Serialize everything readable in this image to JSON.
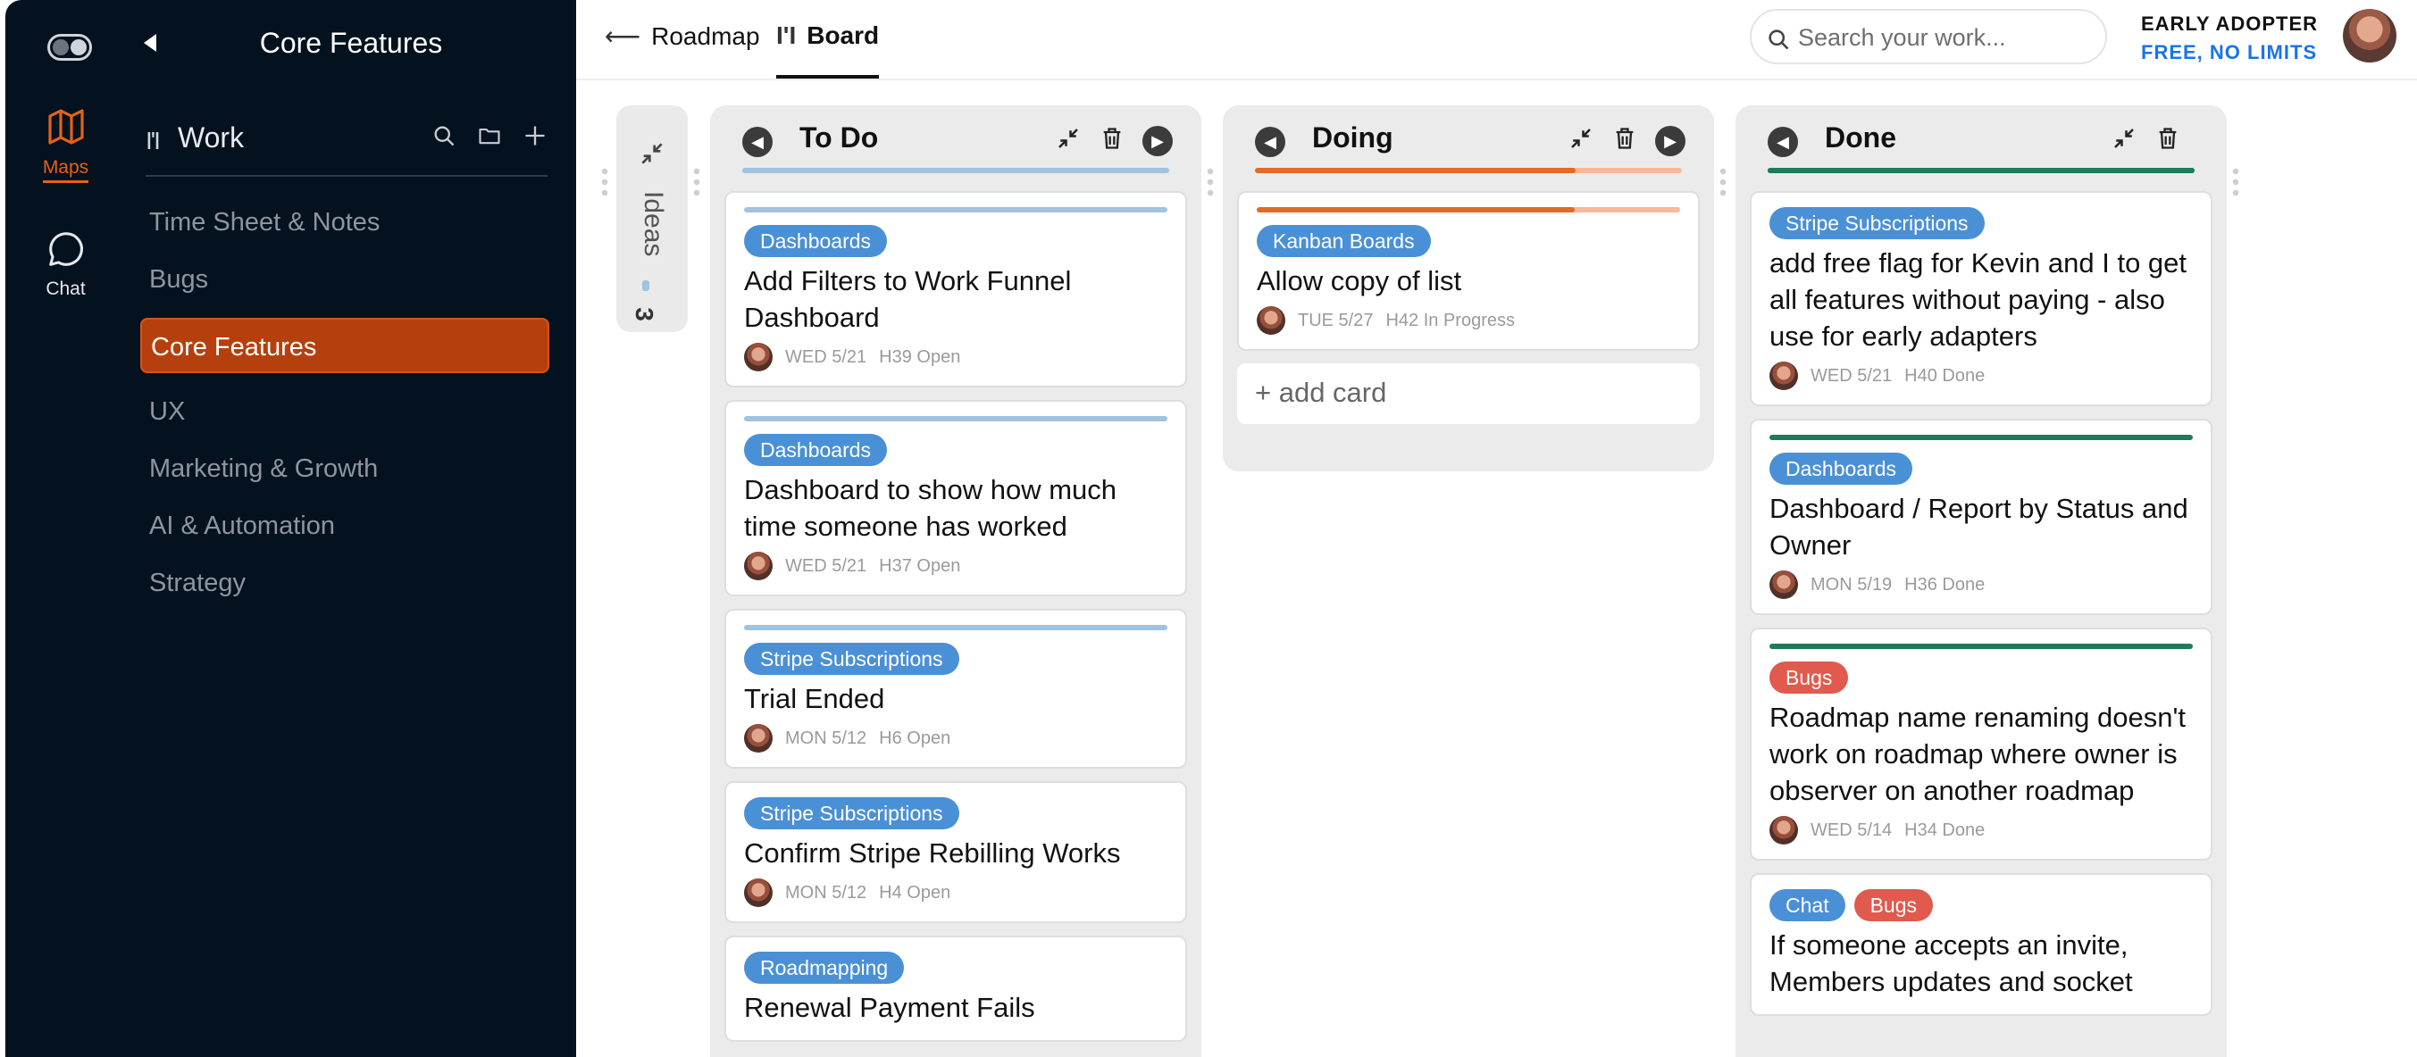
{
  "rail": {
    "maps_label": "Maps",
    "chat_label": "Chat"
  },
  "sidebar": {
    "title": "Core Features",
    "section_label": "Work",
    "items": [
      {
        "label": "Time Sheet & Notes",
        "active": false
      },
      {
        "label": "Bugs",
        "active": false
      },
      {
        "label": "Core Features",
        "active": true
      },
      {
        "label": "UX",
        "active": false
      },
      {
        "label": "Marketing & Growth",
        "active": false
      },
      {
        "label": "AI & Automation",
        "active": false
      },
      {
        "label": "Strategy",
        "active": false
      }
    ]
  },
  "topbar": {
    "tabs": [
      {
        "label": "Roadmap",
        "icon": "roadmap-icon",
        "active": false
      },
      {
        "label": "Board",
        "icon": "board-icon",
        "active": true
      }
    ],
    "search_placeholder": "Search your work...",
    "plan_title": "EARLY ADOPTER",
    "plan_subtitle": "FREE, NO LIMITS"
  },
  "colors": {
    "accent": "#e46218",
    "active_item": "#b6400d",
    "tag_blue": "#4a90d6",
    "tag_red": "#e05a4e",
    "todo_bar": "#9fc3e0",
    "doing_bar": "#e46a25",
    "doing_bar_light": "#f6b99a",
    "done_bar": "#1f7a5c",
    "link_blue": "#1a73e8"
  },
  "board": {
    "collapsed_column": {
      "title": "Ideas",
      "count": "3"
    },
    "columns": [
      {
        "title": "To Do",
        "bar_color": "#9fc3e0",
        "progress": 1.0,
        "cards": [
          {
            "tags": [
              {
                "label": "Dashboards",
                "color": "#4a90d6"
              }
            ],
            "stripe": "#9fc3e0",
            "text": "Add Filters to Work Funnel Dashboard",
            "date": "WED 5/21",
            "status": "H39 Open"
          },
          {
            "tags": [
              {
                "label": "Dashboards",
                "color": "#4a90d6"
              }
            ],
            "stripe": "#9fc3e0",
            "text": "Dashboard to show how much time someone has worked",
            "date": "WED 5/21",
            "status": "H37 Open"
          },
          {
            "tags": [
              {
                "label": "Stripe Subscriptions",
                "color": "#4a90d6"
              }
            ],
            "stripe": "#9fc3e0",
            "text": "Trial Ended",
            "date": "MON 5/12",
            "status": "H6 Open"
          },
          {
            "tags": [
              {
                "label": "Stripe Subscriptions",
                "color": "#4a90d6"
              }
            ],
            "stripe": "",
            "text": "Confirm Stripe Rebilling Works",
            "date": "MON 5/12",
            "status": "H4 Open"
          },
          {
            "tags": [
              {
                "label": "Roadmapping",
                "color": "#4a90d6"
              }
            ],
            "stripe": "",
            "text": "Renewal Payment Fails",
            "date": "",
            "status": ""
          }
        ]
      },
      {
        "title": "Doing",
        "bar_color": "#e46a25",
        "progress": 0.75,
        "cards": [
          {
            "tags": [
              {
                "label": "Kanban Boards",
                "color": "#4a90d6"
              }
            ],
            "stripe": "#e46a25",
            "stripe_progress": 0.75,
            "text": "Allow copy of list",
            "date": "TUE 5/27",
            "status": "H42 In Progress"
          }
        ],
        "add_card_label": "+ add card"
      },
      {
        "title": "Done",
        "bar_color": "#1f7a5c",
        "progress": 1.0,
        "cards": [
          {
            "tags": [
              {
                "label": "Stripe Subscriptions",
                "color": "#4a90d6"
              }
            ],
            "stripe": "",
            "text": "add free flag for Kevin and I to get all features without paying - also use for early adapters",
            "date": "WED 5/21",
            "status": "H40 Done"
          },
          {
            "tags": [
              {
                "label": "Dashboards",
                "color": "#4a90d6"
              }
            ],
            "stripe": "#1f7a5c",
            "text": "Dashboard / Report by Status and Owner",
            "date": "MON 5/19",
            "status": "H36 Done"
          },
          {
            "tags": [
              {
                "label": "Bugs",
                "color": "#e05a4e"
              }
            ],
            "stripe": "#1f7a5c",
            "text": "Roadmap name renaming doesn't work on roadmap where owner is observer on another roadmap",
            "date": "WED 5/14",
            "status": "H34 Done"
          },
          {
            "tags": [
              {
                "label": "Chat",
                "color": "#4a90d6"
              },
              {
                "label": "Bugs",
                "color": "#e05a4e"
              }
            ],
            "stripe": "",
            "text": "If someone accepts an invite, Members updates and socket",
            "date": "",
            "status": ""
          }
        ]
      }
    ]
  }
}
